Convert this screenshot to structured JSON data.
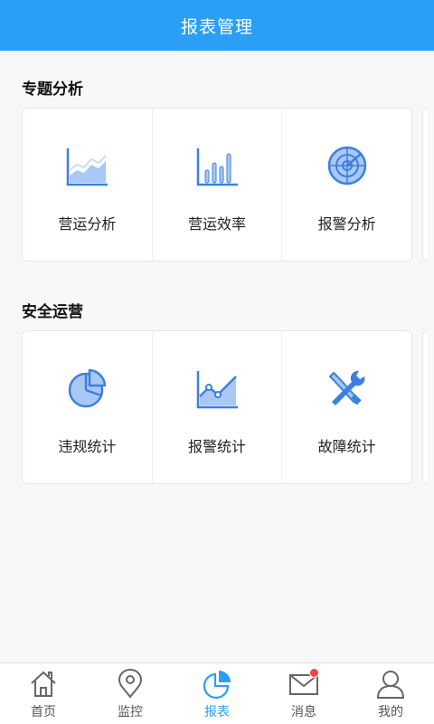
{
  "header": {
    "title": "报表管理"
  },
  "sections": [
    {
      "title": "专题分析",
      "tiles": [
        {
          "label": "营运分析",
          "icon": "area-chart-icon"
        },
        {
          "label": "营运效率",
          "icon": "bar-chart-icon"
        },
        {
          "label": "报警分析",
          "icon": "radar-icon"
        }
      ]
    },
    {
      "title": "安全运营",
      "tiles": [
        {
          "label": "违规统计",
          "icon": "pie-chart-icon"
        },
        {
          "label": "报警统计",
          "icon": "line-chart-icon"
        },
        {
          "label": "故障统计",
          "icon": "tools-icon"
        }
      ]
    }
  ],
  "tabbar": {
    "active": "报表",
    "items": [
      {
        "label": "首页",
        "icon": "home-icon"
      },
      {
        "label": "监控",
        "icon": "location-pin-icon"
      },
      {
        "label": "报表",
        "icon": "report-pie-icon"
      },
      {
        "label": "消息",
        "icon": "mail-icon",
        "badge": true
      },
      {
        "label": "我的",
        "icon": "user-icon"
      }
    ]
  },
  "colors": {
    "primary": "#2a9ff5",
    "icon_blue": "#3d7fe0",
    "icon_light": "#a9c8f5",
    "badge": "#f5433b"
  }
}
